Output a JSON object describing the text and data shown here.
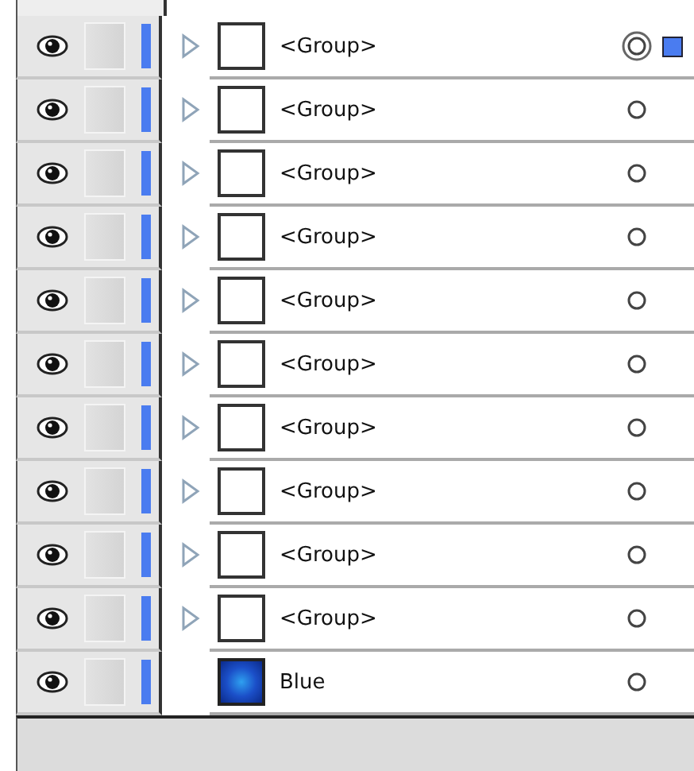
{
  "layers": [
    {
      "name": "<Group>",
      "kind": "group",
      "targeted": true,
      "selected": true
    },
    {
      "name": "<Group>",
      "kind": "group",
      "targeted": false,
      "selected": false
    },
    {
      "name": "<Group>",
      "kind": "group",
      "targeted": false,
      "selected": false
    },
    {
      "name": "<Group>",
      "kind": "group",
      "targeted": false,
      "selected": false
    },
    {
      "name": "<Group>",
      "kind": "group",
      "targeted": false,
      "selected": false
    },
    {
      "name": "<Group>",
      "kind": "group",
      "targeted": false,
      "selected": false
    },
    {
      "name": "<Group>",
      "kind": "group",
      "targeted": false,
      "selected": false
    },
    {
      "name": "<Group>",
      "kind": "group",
      "targeted": false,
      "selected": false
    },
    {
      "name": "<Group>",
      "kind": "group",
      "targeted": false,
      "selected": false
    },
    {
      "name": "<Group>",
      "kind": "group",
      "targeted": false,
      "selected": false
    },
    {
      "name": "Blue",
      "kind": "swatch",
      "targeted": false,
      "selected": false
    }
  ]
}
